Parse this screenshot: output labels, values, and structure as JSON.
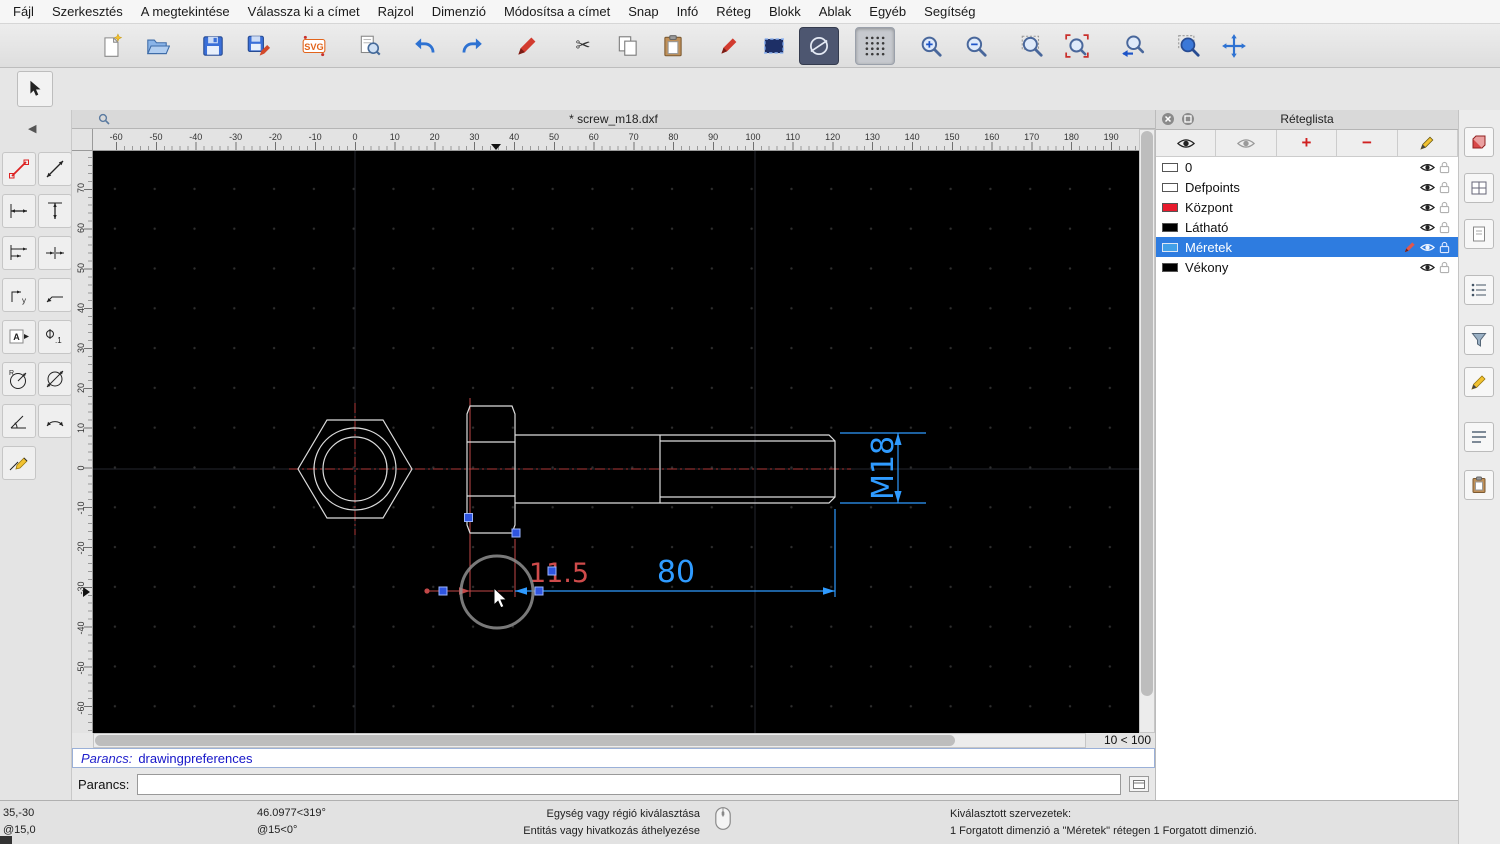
{
  "menubar": {
    "items": [
      "Fájl",
      "Szerkesztés",
      "A megtekintése",
      "Válassza ki a címet",
      "Rajzol",
      "Dimenzió",
      "Módosítsa a címet",
      "Snap",
      "Infó",
      "Réteg",
      "Blokk",
      "Ablak",
      "Egyéb",
      "Segítség"
    ]
  },
  "document": {
    "tab_title": "* screw_m18.dxf",
    "grid_indicator": "10 < 100"
  },
  "rulers": {
    "horizontal": [
      "-60",
      "-50",
      "-40",
      "-30",
      "-20",
      "-10",
      "0",
      "10",
      "20",
      "30",
      "40",
      "50",
      "60",
      "70",
      "80",
      "90",
      "100",
      "110",
      "120",
      "130",
      "140",
      "150",
      "160",
      "170",
      "180",
      "190"
    ],
    "vertical": [
      "70",
      "60",
      "50",
      "40",
      "30",
      "20",
      "10",
      "0",
      "-10",
      "-20",
      "-30",
      "-40",
      "-50",
      "-60"
    ]
  },
  "drawing": {
    "dim_length": "80",
    "dim_head": "11.5",
    "dim_thread": "M18"
  },
  "layer_panel": {
    "title": "Réteglista",
    "layers": [
      {
        "name": "0",
        "color": "#ffffff",
        "selected": false
      },
      {
        "name": "Defpoints",
        "color": "#ffffff",
        "selected": false
      },
      {
        "name": "Központ",
        "color": "#e81b2d",
        "selected": false
      },
      {
        "name": "Látható",
        "color": "#000000",
        "selected": false
      },
      {
        "name": "Méretek",
        "color": "#42a0e8",
        "selected": true
      },
      {
        "name": "Vékony",
        "color": "#000000",
        "selected": false
      }
    ]
  },
  "command": {
    "history_label": "Parancs:",
    "history_value": "drawingpreferences",
    "prompt_label": "Parancs:",
    "input_value": ""
  },
  "status": {
    "abs_coord": "35,-30",
    "rel_coord": "@15,0",
    "polar_abs": "46.0977<319°",
    "polar_rel": "@15<0°",
    "hint_line1": "Egység vagy régió kiválasztása",
    "hint_line2": "Entitás vagy hivatkozás áthelyezése",
    "selection_line1": "Kiválasztott szervezetek:",
    "selection_line2": "1 Forgatott dimenzió a \"Méretek\" rétegen 1 Forgatott dimenzió."
  },
  "icons": {
    "cut": "✂",
    "collapse_left": "◀",
    "svg_logo": "SVG",
    "plus": "+",
    "minus": "−",
    "glyph_A": "A",
    "glyph_R": "R",
    "glyph_y": "y",
    "glyph_tol": ".1"
  },
  "colors": {
    "dim_blue": "#2f9bff",
    "dim_red": "#cf4b4b",
    "selected_row": "#2e7ce0",
    "layer_red": "#e81b2d",
    "layer_blue": "#42a0e8"
  }
}
